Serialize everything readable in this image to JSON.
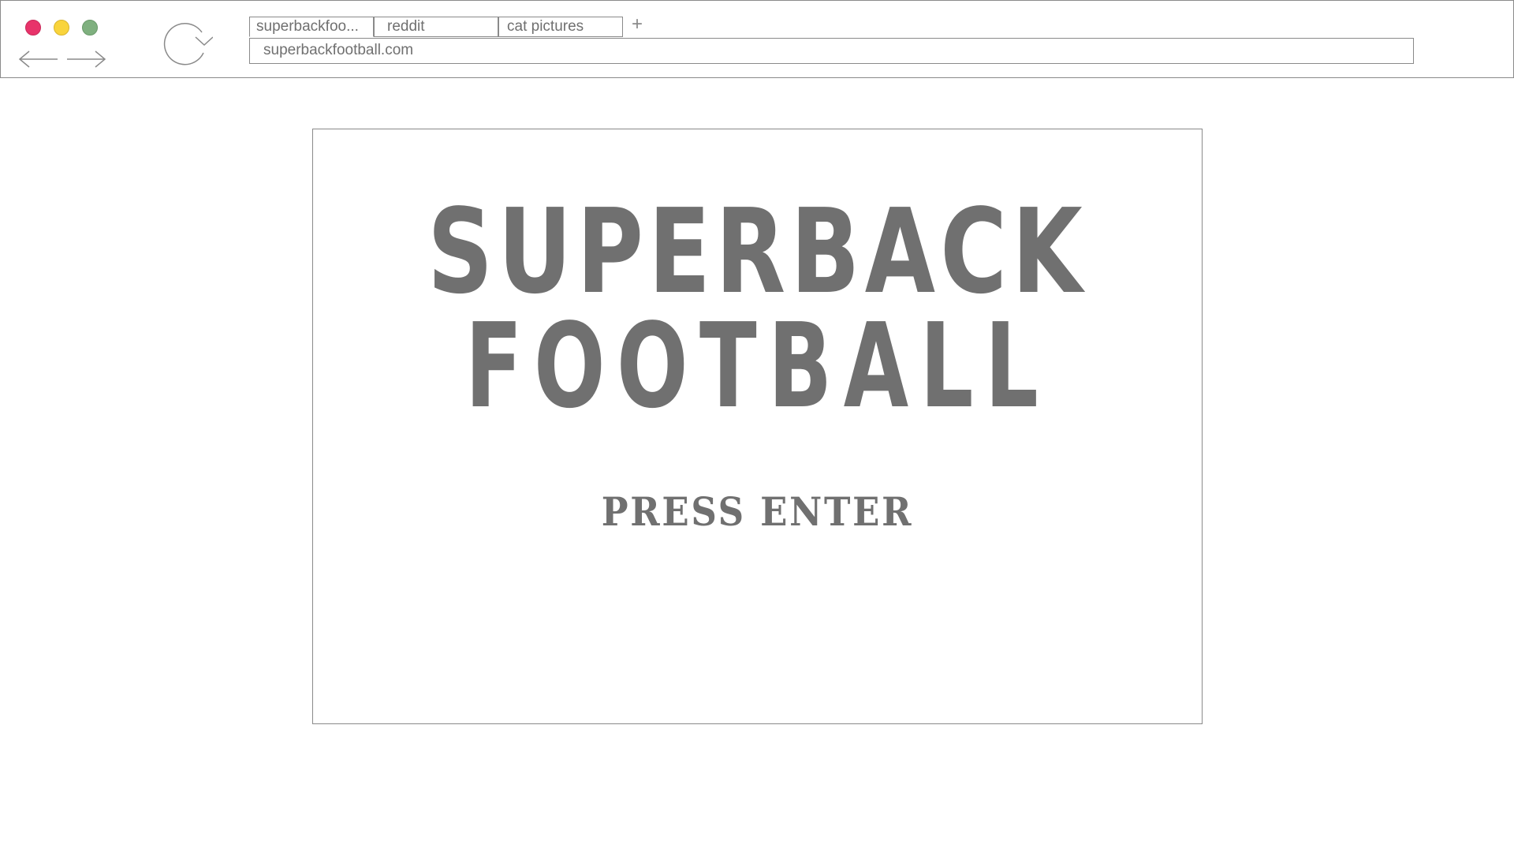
{
  "window": {
    "controls": {
      "close_color": "#e8336a",
      "minimize_color": "#f9d43c",
      "maximize_color": "#7fb07f"
    },
    "icons": {
      "back": "arrow-left-icon",
      "forward": "arrow-right-icon",
      "reload": "reload-icon",
      "new_tab": "plus-icon"
    }
  },
  "tabs": [
    {
      "label": "superbackfoo...",
      "active": true
    },
    {
      "label": "reddit",
      "active": false
    },
    {
      "label": "cat pictures",
      "active": false
    }
  ],
  "new_tab_label": "+",
  "address_bar": {
    "url": "superbackfootball.com"
  },
  "game": {
    "title_line_1": "SUPERBACK",
    "title_line_2": "FOOTBALL",
    "prompt": "PRESS ENTER",
    "text_color": "#707070"
  }
}
